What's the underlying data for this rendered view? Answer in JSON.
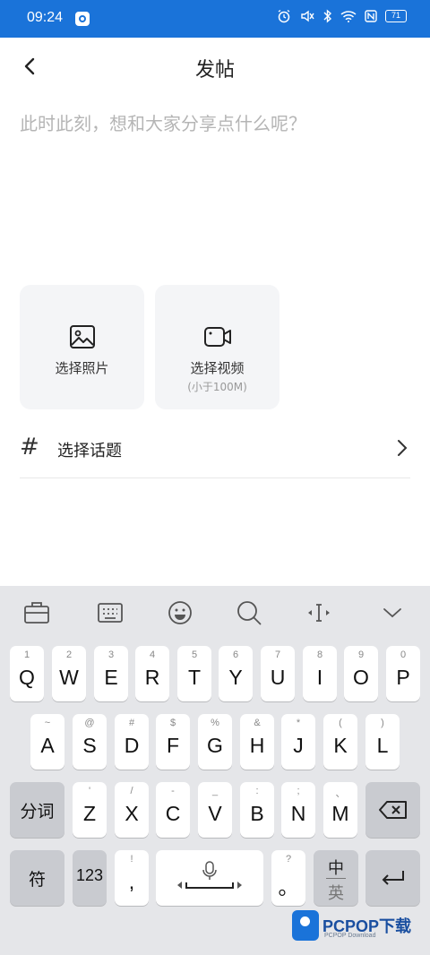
{
  "status_bar": {
    "time": "09:24",
    "battery": "71"
  },
  "header": {
    "title": "发帖"
  },
  "composer": {
    "placeholder": "此时此刻，想和大家分享点什么呢？"
  },
  "media": {
    "photo": {
      "label": "选择照片"
    },
    "video": {
      "label": "选择视频",
      "sublabel": "(小于100M)"
    }
  },
  "topic": {
    "hash": "#",
    "label": "选择话题"
  },
  "keyboard": {
    "row1": [
      {
        "sup": "1",
        "main": "Q"
      },
      {
        "sup": "2",
        "main": "W"
      },
      {
        "sup": "3",
        "main": "E"
      },
      {
        "sup": "4",
        "main": "R"
      },
      {
        "sup": "5",
        "main": "T"
      },
      {
        "sup": "6",
        "main": "Y"
      },
      {
        "sup": "7",
        "main": "U"
      },
      {
        "sup": "8",
        "main": "I"
      },
      {
        "sup": "9",
        "main": "O"
      },
      {
        "sup": "0",
        "main": "P"
      }
    ],
    "row2": [
      {
        "sup": "~",
        "main": "A"
      },
      {
        "sup": "@",
        "main": "S"
      },
      {
        "sup": "#",
        "main": "D"
      },
      {
        "sup": "$",
        "main": "F"
      },
      {
        "sup": "%",
        "main": "G"
      },
      {
        "sup": "&",
        "main": "H"
      },
      {
        "sup": "*",
        "main": "J"
      },
      {
        "sup": "(",
        "main": "K"
      },
      {
        "sup": ")",
        "main": "L"
      }
    ],
    "row3": [
      {
        "sup": "'",
        "main": "Z"
      },
      {
        "sup": "/",
        "main": "X"
      },
      {
        "sup": "-",
        "main": "C"
      },
      {
        "sup": "_",
        "main": "V"
      },
      {
        "sup": ":",
        "main": "B"
      },
      {
        "sup": ";",
        "main": "N"
      },
      {
        "sup": "、",
        "main": "M"
      }
    ],
    "fenci": "分词",
    "fu": "符",
    "num": "123",
    "comma": {
      "sup": "!",
      "main": ","
    },
    "period": {
      "sup": "?",
      "main": "。"
    },
    "lang_top": "中",
    "lang_bottom": "英"
  },
  "watermark": {
    "brand": "PCPOP下载",
    "sub": "PCPOP Download"
  }
}
